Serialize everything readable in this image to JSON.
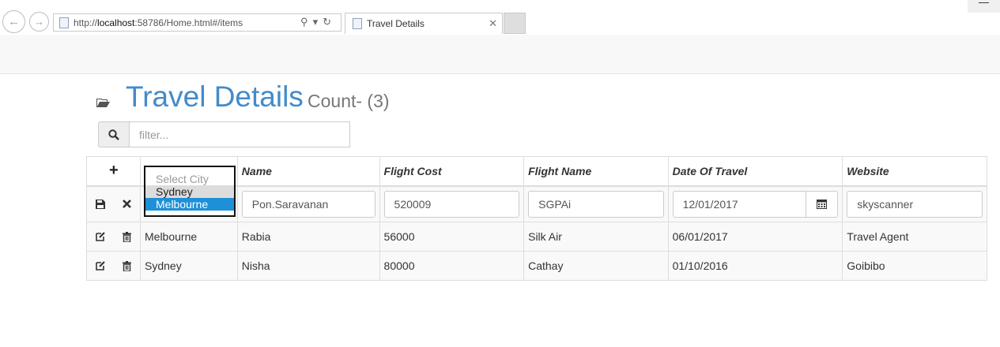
{
  "browser": {
    "url_prefix": "http://",
    "url_host": "localhost",
    "url_rest": ":58786/Home.html#/items",
    "tab_title": "Travel Details",
    "minimize_glyph": "—"
  },
  "page": {
    "title": "Travel Details",
    "count_label": "Count- (3)",
    "filter_placeholder": "filter...",
    "folder_icon": "folder-open-icon",
    "search_icon": "search-icon"
  },
  "table": {
    "add_glyph": "+",
    "columns": [
      "Name",
      "Flight Cost",
      "Flight Name",
      "Date Of Travel",
      "Website"
    ],
    "edit_row": {
      "city_options": [
        "Select City",
        "Sydney",
        "Melbourne"
      ],
      "city_selected": "Melbourne",
      "name": "Pon.Saravanan",
      "flight_cost": "520009",
      "flight_name": "SGPAi",
      "date_of_travel": "12/01/2017",
      "website": "skyscanner"
    },
    "rows": [
      {
        "city": "Melbourne",
        "name": "Rabia",
        "flight_cost": "56000",
        "flight_name": "Silk Air",
        "date_of_travel": "06/01/2017",
        "website": "Travel Agent"
      },
      {
        "city": "Sydney",
        "name": "Nisha",
        "flight_cost": "80000",
        "flight_name": "Cathay",
        "date_of_travel": "01/10/2016",
        "website": "Goibibo"
      }
    ]
  },
  "colors": {
    "title": "#428bca",
    "selected_option": "#1e90d8"
  }
}
